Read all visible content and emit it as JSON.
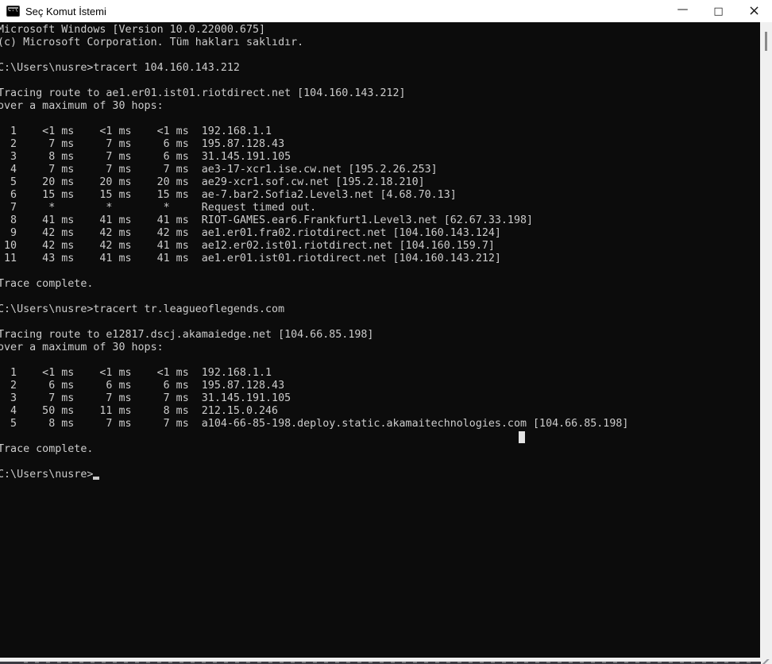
{
  "window": {
    "title": "Seç Komut İstemi"
  },
  "icons": {
    "app_glyph": "C:\\",
    "minimize_glyph": "—",
    "maximize_glyph": "□",
    "close_glyph": "×"
  },
  "console": {
    "lines": [
      "Microsoft Windows [Version 10.0.22000.675]",
      "(c) Microsoft Corporation. Tüm hakları saklıdır.",
      "",
      "C:\\Users\\nusre>tracert 104.160.143.212",
      "",
      "Tracing route to ae1.er01.ist01.riotdirect.net [104.160.143.212]",
      "over a maximum of 30 hops:",
      "",
      "  1    <1 ms    <1 ms    <1 ms  192.168.1.1",
      "  2     7 ms     7 ms     6 ms  195.87.128.43",
      "  3     8 ms     7 ms     6 ms  31.145.191.105",
      "  4     7 ms     7 ms     7 ms  ae3-17-xcr1.ise.cw.net [195.2.26.253]",
      "  5    20 ms    20 ms    20 ms  ae29-xcr1.sof.cw.net [195.2.18.210]",
      "  6    15 ms    15 ms    15 ms  ae-7.bar2.Sofia2.Level3.net [4.68.70.13]",
      "  7     *        *        *     Request timed out.",
      "  8    41 ms    41 ms    41 ms  RIOT-GAMES.ear6.Frankfurt1.Level3.net [62.67.33.198]",
      "  9    42 ms    42 ms    42 ms  ae1.er01.fra02.riotdirect.net [104.160.143.124]",
      " 10    42 ms    42 ms    41 ms  ae12.er02.ist01.riotdirect.net [104.160.159.7]",
      " 11    43 ms    41 ms    41 ms  ae1.er01.ist01.riotdirect.net [104.160.143.212]",
      "",
      "Trace complete.",
      "",
      "C:\\Users\\nusre>tracert tr.leagueoflegends.com",
      "",
      "Tracing route to e12817.dscj.akamaiedge.net [104.66.85.198]",
      "over a maximum of 30 hops:",
      "",
      "  1    <1 ms    <1 ms    <1 ms  192.168.1.1",
      "  2     6 ms     6 ms     6 ms  195.87.128.43",
      "  3     7 ms     7 ms     7 ms  31.145.191.105",
      "  4    50 ms    11 ms     8 ms  212.15.0.246",
      "  5     8 ms     7 ms     7 ms  a104-66-85-198.deploy.static.akamaitechnologies.com [104.66.85.198]",
      "",
      "Trace complete.",
      "",
      "C:\\Users\\nusre>"
    ],
    "colors": {
      "background": "#0c0c0c",
      "text": "#cccccc",
      "titlebar_background": "#ffffff",
      "titlebar_text": "#000000",
      "scrollbar_track": "#f0f0f0",
      "scrollbar_thumb": "#8a8a8a"
    }
  }
}
